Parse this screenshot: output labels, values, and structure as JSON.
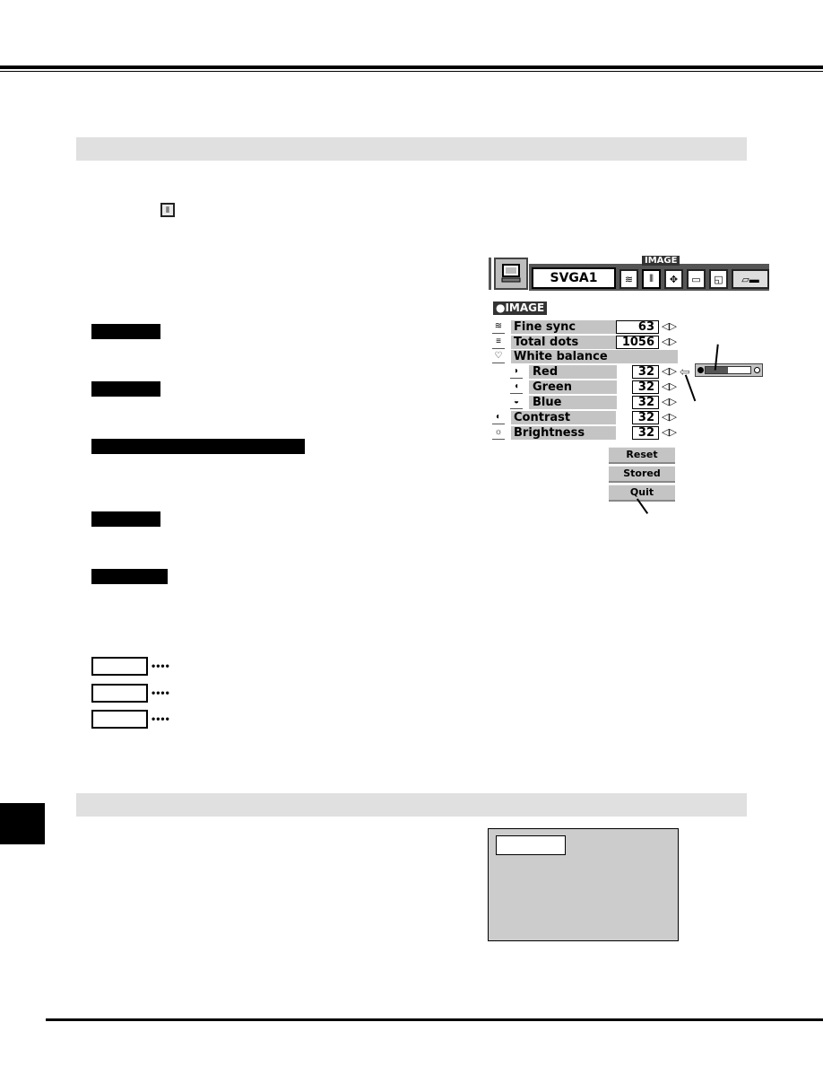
{
  "page": {
    "section_bars": [
      "",
      ""
    ],
    "inline_icon": "image-adjust-icon",
    "label_boxes_black": [
      "",
      "",
      "",
      "",
      ""
    ],
    "label_boxes_outline": [
      {
        "dots": "••••"
      },
      {
        "dots": "••••"
      },
      {
        "dots": "••••"
      }
    ]
  },
  "osd_menu": {
    "mode": "SVGA1",
    "tooltip": "IMAGE",
    "title": "●IMAGE",
    "toolbar_icons": [
      "monitor-icon",
      "fine-sync-icon",
      "image-adjust-icon",
      "position-icon",
      "pc-adjust-icon",
      "screen-icon",
      "setting-icon"
    ],
    "rows": [
      {
        "icon": "fine-sync-icon",
        "label": "Fine sync",
        "value": "63",
        "indent": false
      },
      {
        "icon": "total-dots-icon",
        "label": "Total dots",
        "value": "1056",
        "indent": false
      },
      {
        "icon": "white-balance-icon",
        "label": "White balance",
        "value": null,
        "indent": false
      },
      {
        "icon": "red-icon",
        "label": "Red",
        "value": "32",
        "indent": true
      },
      {
        "icon": "green-icon",
        "label": "Green",
        "value": "32",
        "indent": true
      },
      {
        "icon": "blue-icon",
        "label": "Blue",
        "value": "32",
        "indent": true
      },
      {
        "icon": "contrast-icon",
        "label": "Contrast",
        "value": "32",
        "indent": false
      },
      {
        "icon": "brightness-icon",
        "label": "Brightness",
        "value": "32",
        "indent": false
      }
    ],
    "buttons": {
      "reset": "Reset",
      "stored": "Stored",
      "quit": "Quit"
    },
    "slider": {
      "level_fraction": 0.5
    }
  }
}
